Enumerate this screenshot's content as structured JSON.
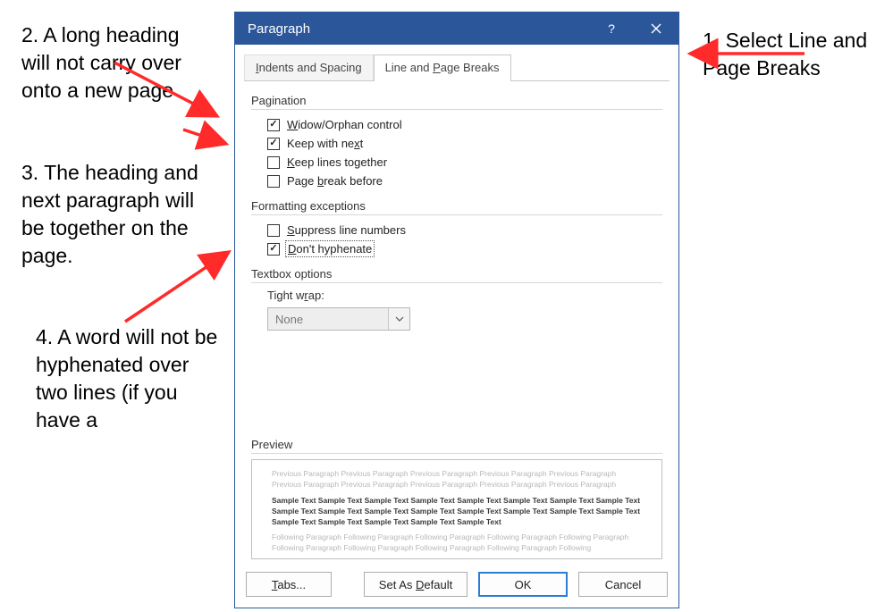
{
  "dialog": {
    "title": "Paragraph",
    "tabs": {
      "indents": "Indents and Spacing",
      "linepage": "Line and Page Breaks"
    },
    "groups": {
      "pagination": {
        "label": "Pagination",
        "widow": {
          "text": "Widow/Orphan control",
          "checked": true
        },
        "keepnext": {
          "text": "Keep with next",
          "checked": true
        },
        "keeplines": {
          "text": "Keep lines together",
          "checked": false
        },
        "pagebreak": {
          "text": "Page break before",
          "checked": false
        }
      },
      "formatting": {
        "label": "Formatting exceptions",
        "suppress": {
          "text": "Suppress line numbers",
          "checked": false
        },
        "donthyph": {
          "text": "Don't hyphenate",
          "checked": true
        }
      },
      "textbox": {
        "label": "Textbox options",
        "tightwrap_label": "Tight wrap:",
        "tightwrap_value": "None"
      },
      "preview": {
        "label": "Preview",
        "previous": "Previous Paragraph Previous Paragraph Previous Paragraph Previous Paragraph Previous Paragraph Previous Paragraph Previous Paragraph Previous Paragraph Previous Paragraph Previous Paragraph",
        "sample": "Sample Text Sample Text Sample Text Sample Text Sample Text Sample Text Sample Text Sample Text Sample Text Sample Text Sample Text Sample Text Sample Text Sample Text Sample Text Sample Text Sample Text Sample Text Sample Text Sample Text Sample Text",
        "following": "Following Paragraph Following Paragraph Following Paragraph Following Paragraph Following Paragraph Following Paragraph Following Paragraph Following Paragraph Following Paragraph Following"
      }
    },
    "buttons": {
      "tabs": "Tabs...",
      "setdefault": "Set As Default",
      "ok": "OK",
      "cancel": "Cancel"
    }
  },
  "annotations": {
    "a1": "1. Select Line and Page Breaks",
    "a2": "2. A long heading will not carry over onto a new page",
    "a3": "3. The heading and next paragraph will be together on the page.",
    "a4": "4. A word will not be hyphenated over two lines (if you have a"
  }
}
